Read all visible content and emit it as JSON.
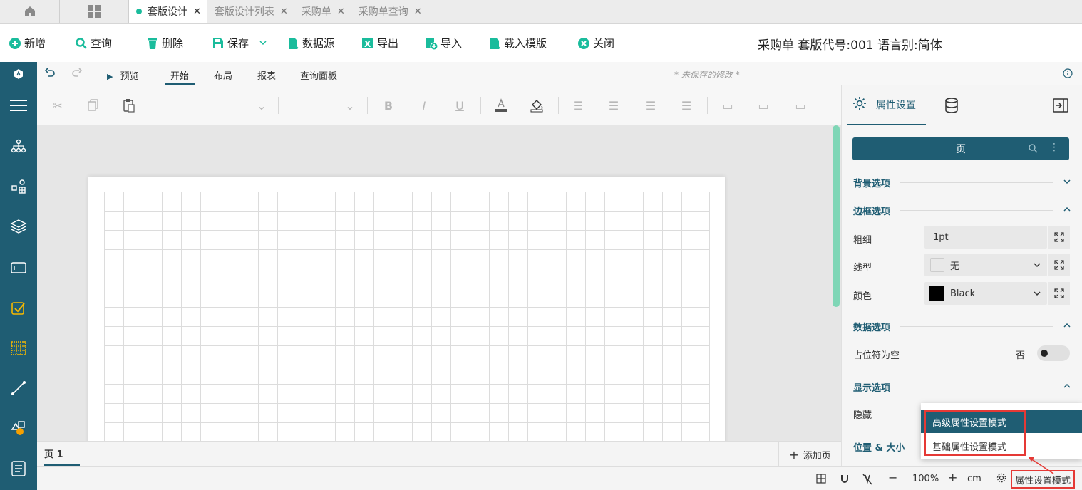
{
  "tabs": [
    {
      "label": "套版设计",
      "active": true
    },
    {
      "label": "套版设计列表",
      "active": false
    },
    {
      "label": "采购单",
      "active": false
    },
    {
      "label": "采购单查询",
      "active": false
    }
  ],
  "toolbar": {
    "new": "新增",
    "query": "查询",
    "delete": "删除",
    "save": "保存",
    "datasource": "数据源",
    "export": "导出",
    "import": "导入",
    "load_template": "载入模版",
    "close": "关闭",
    "title": "采购单 套版代号:001 语言别:简体"
  },
  "ribbon": {
    "preview": "预览",
    "tabs": [
      "开始",
      "布局",
      "报表",
      "查询面板"
    ],
    "unsaved": "* 未保存的修改 *"
  },
  "page_tabs": {
    "page1": "页 1",
    "add_page": "添加页"
  },
  "status": {
    "zoom": "100%",
    "unit": "cm",
    "prop_mode": "属性设置模式"
  },
  "panel": {
    "tab_properties": "属性设置",
    "selector": "页",
    "sections": {
      "background": "背景选项",
      "border": "边框选项",
      "data": "数据选项",
      "display": "显示选项",
      "position": "位置 & 大小"
    },
    "fields": {
      "thickness_label": "粗细",
      "thickness_value": "1pt",
      "linetype_label": "线型",
      "linetype_value": "无",
      "color_label": "颜色",
      "color_value": "Black",
      "placeholder_label": "占位符为空",
      "placeholder_value": "否",
      "hidden_label": "隐藏"
    }
  },
  "popup": {
    "advanced": "高级属性设置模式",
    "basic": "基础属性设置模式"
  },
  "colors": {
    "accent": "#1f5d73",
    "green": "#1abc9c",
    "highlight": "#e53935"
  }
}
